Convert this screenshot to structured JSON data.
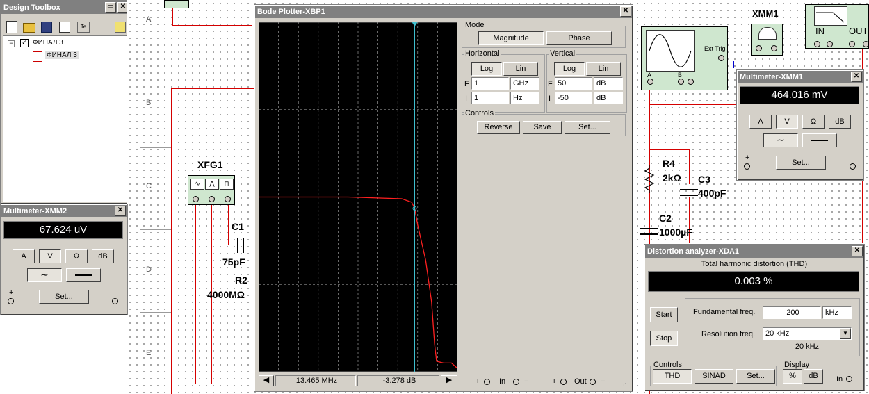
{
  "toolbox": {
    "title": "Design Toolbox",
    "tree_root": "ФИНАЛ 3",
    "tree_child": "ФИНАЛ 3"
  },
  "schematic": {
    "row_labels": [
      "A",
      "B",
      "C",
      "D",
      "E"
    ],
    "xfg1": "XFG1",
    "c1": "C1",
    "c1_value": "75pF",
    "r2": "R2",
    "r2_value": "4000MΩ",
    "xmm1": "XMM1",
    "r4": "R4",
    "r4_value": "2kΩ",
    "c3": "C3",
    "c3_value": "400pF",
    "c2": "C2",
    "c2_value": "1000µF",
    "scope_ext_trig": "Ext Trig",
    "scope_a": "A",
    "scope_b": "B",
    "bode_in": "IN",
    "bode_out": "OUT"
  },
  "mm2": {
    "title": "Multimeter-XMM2",
    "reading": "67.624 uV",
    "btn_a": "A",
    "btn_v": "V",
    "btn_ohm": "Ω",
    "btn_db": "dB",
    "set": "Set..."
  },
  "mm1": {
    "title": "Multimeter-XMM1",
    "reading": "464.016 mV",
    "btn_a": "A",
    "btn_v": "V",
    "btn_ohm": "Ω",
    "btn_db": "dB",
    "set": "Set..."
  },
  "bode": {
    "title": "Bode Plotter-XBP1",
    "mode_label": "Mode",
    "magnitude": "Magnitude",
    "phase": "Phase",
    "horizontal_label": "Horizontal",
    "vertical_label": "Vertical",
    "log": "Log",
    "lin": "Lin",
    "f": "F",
    "i": "I",
    "h_f_value": "1",
    "h_f_unit": "GHz",
    "h_i_value": "1",
    "h_i_unit": "Hz",
    "v_f_value": "50",
    "v_f_unit": "dB",
    "v_i_value": "-50",
    "v_i_unit": "dB",
    "controls_label": "Controls",
    "reverse": "Reverse",
    "save": "Save",
    "set": "Set...",
    "cursor_freq": "13.465 MHz",
    "cursor_gain": "-3.278 dB",
    "in_label": "In",
    "out_label": "Out",
    "plus": "+",
    "minus": "−"
  },
  "xda": {
    "title": "Distortion analyzer-XDA1",
    "thd_label": "Total harmonic distortion (THD)",
    "thd_value": "0.003 %",
    "start": "Start",
    "stop": "Stop",
    "fund_label": "Fundamental freq.",
    "fund_value": "200",
    "fund_unit": "kHz",
    "res_label": "Resolution freq.",
    "res_value": "20 kHz",
    "res_readout": "20 kHz",
    "controls_label": "Controls",
    "thd_btn": "THD",
    "sinad_btn": "SINAD",
    "set": "Set...",
    "display_label": "Display",
    "pct_btn": "%",
    "db_btn": "dB",
    "in_label": "In"
  },
  "chart_data": {
    "type": "line",
    "title": "",
    "xlabel": "",
    "ylabel": "",
    "x_scale": "log",
    "x_range": [
      "1 Hz",
      "1 GHz"
    ],
    "ylim": [
      -50,
      50
    ],
    "grid": true,
    "series": [
      {
        "color": "#ff2020",
        "points": [
          [
            0.0,
            0.0
          ],
          [
            0.45,
            0.0
          ],
          [
            0.72,
            -0.5
          ],
          [
            0.77,
            -1.5
          ],
          [
            0.785,
            -3.278
          ],
          [
            0.8,
            -8
          ],
          [
            0.84,
            -18
          ],
          [
            0.87,
            -30
          ],
          [
            0.885,
            -42
          ],
          [
            0.895,
            -47
          ],
          [
            0.93,
            -47.5
          ],
          [
            0.97,
            -47.5
          ],
          [
            1.0,
            -49
          ]
        ]
      }
    ],
    "cursor_position": 0.785
  }
}
